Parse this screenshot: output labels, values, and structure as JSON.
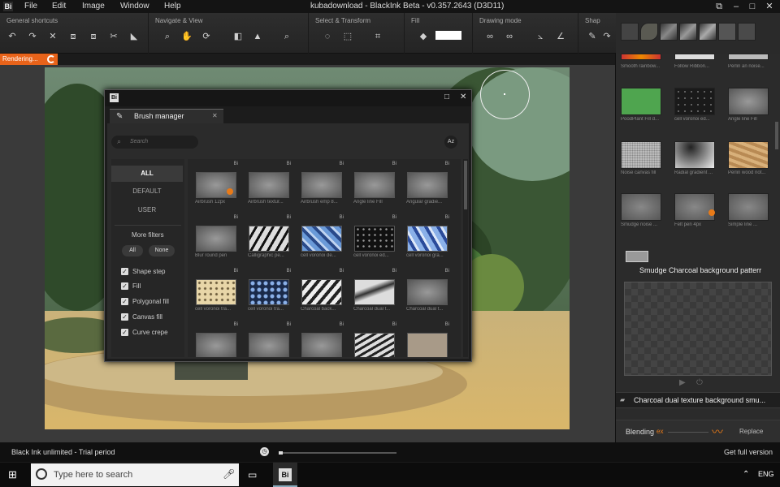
{
  "menubar": {
    "logo": "Bi",
    "items": [
      "File",
      "Edit",
      "Image",
      "Window",
      "Help"
    ],
    "title": "kubadownload - BlackInk Beta - v0.357.2643 (D3D11)"
  },
  "toolbar": {
    "groups": [
      "General shortcuts",
      "Navigate & View",
      "Select & Transform",
      "Fill",
      "Drawing mode",
      "Shap"
    ]
  },
  "render": {
    "label": "Rendering..."
  },
  "right_panel": {
    "brush_rows": [
      [
        "Smooth rainbow...",
        "Follow Ribbon...",
        "Perlin an noise..."
      ],
      [
        "PoodPlant Fill d...",
        "cell voronoi ed...",
        "Angle line Fill"
      ],
      [
        "Noise canvas fill",
        "Radial gradient ...",
        "Perlin wood not..."
      ],
      [
        "Smudge noise ...",
        "Felt pen 4px",
        "Simple line ..."
      ]
    ],
    "selected_brush": "Smudge Charcoal background patterr",
    "strip_name": "Charcoal dual texture background smu...",
    "blending_label": "Blending",
    "blending_value": "ex",
    "replace_label": "Replace"
  },
  "dialog": {
    "logo": "Bi",
    "tab": "Brush manager",
    "search_placeholder": "Search",
    "sort_label": "Az",
    "filters": [
      "ALL",
      "DEFAULT",
      "USER"
    ],
    "more_filters": "More filters",
    "all_btn": "All",
    "none_btn": "None",
    "checks": [
      "Shape step",
      "Fill",
      "Polygonal fill",
      "Canvas fill",
      "Curve crepe"
    ],
    "grid": [
      [
        "Airbrush 12px",
        "Airbrush textur...",
        "Airbrush emp 8...",
        "Angle line Fill",
        "Angular gradie..."
      ],
      [
        "Blur round pen",
        "Calligraphic pe...",
        "cell voronoi de...",
        "cell voronoi ed...",
        "cell voronoi gra..."
      ],
      [
        "cell voronoi tra...",
        "cell voronoi tra...",
        "Charcoal back...",
        "Charcoal dual t...",
        "Charcoal dual t..."
      ],
      [
        "",
        "",
        "",
        "",
        ""
      ]
    ],
    "badge": "Bi"
  },
  "statusbar": {
    "trial": "Black Ink unlimited - Trial period",
    "get_full": "Get full version"
  },
  "taskbar": {
    "search": "Type here to search",
    "lang": "ENG"
  }
}
